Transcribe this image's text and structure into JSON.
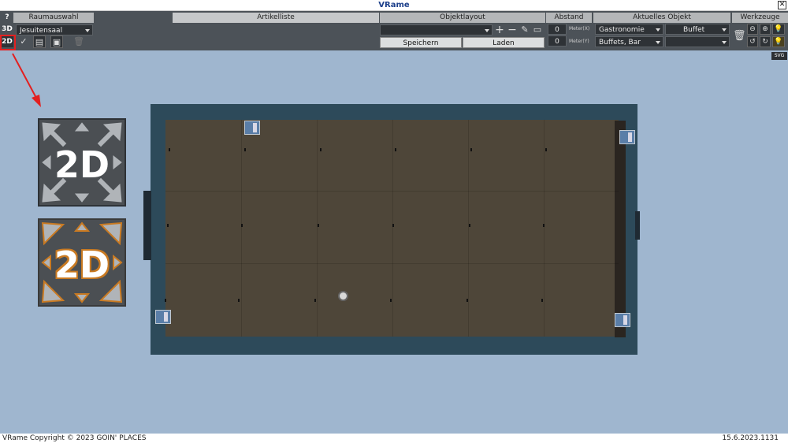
{
  "window": {
    "title": "VRame",
    "close_icon": "close-icon"
  },
  "toolbar": {
    "help_label": "?",
    "mode_3d": "3D",
    "mode_2d": "2D",
    "room": {
      "header": "Raumauswahl",
      "selected": "Jesuitensaal"
    },
    "article_list": {
      "header": "Artikelliste"
    },
    "object_layout": {
      "header": "Objektlayout",
      "selected": "",
      "save_label": "Speichern",
      "load_label": "Laden"
    },
    "distance": {
      "header": "Abstand",
      "x_value": "0",
      "x_unit": "Meter(X)",
      "y_value": "0",
      "y_unit": "Meter(Y)"
    },
    "current_object": {
      "header": "Aktuelles Objekt",
      "category": "Gastronomie",
      "subcategory": "Buffet",
      "type": "Buffets, Bar",
      "variant": ""
    },
    "tools": {
      "header": "Werkzeuge"
    }
  },
  "tooltip": {
    "text": "SVG"
  },
  "view_icons": {
    "normal_label": "2D",
    "active_label": "2D"
  },
  "footer": {
    "copyright": "VRame Copyright © 2023 GOIN' PLACES",
    "version": "15.6.2023.1131"
  },
  "colors": {
    "accent_highlight": "#e32020",
    "active_outline": "#c97a22"
  }
}
